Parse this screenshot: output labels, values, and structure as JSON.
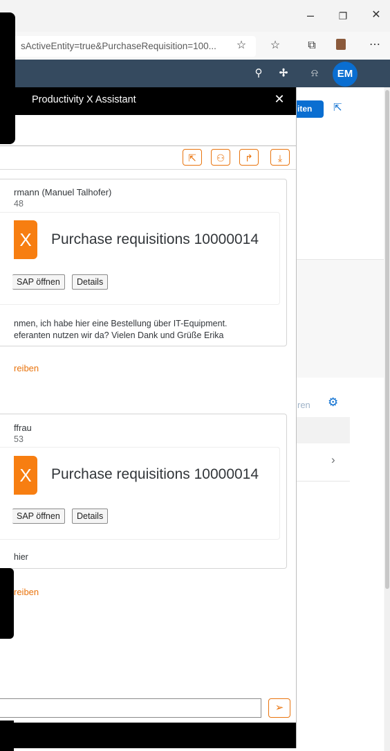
{
  "browser": {
    "url_fragment": "sActiveEntity=true&PurchaseRequisition=100...",
    "window_controls": [
      "–",
      "▢",
      "✕"
    ]
  },
  "shell": {
    "avatar_initials": "EM"
  },
  "background_page": {
    "edit_button_label": "iten",
    "muted_text": "ren"
  },
  "assistant": {
    "title": "Productivity X Assistant",
    "close_label": "✕",
    "cards": [
      {
        "sender": "rmann (Manuel Talhofer)",
        "sender_id": "48",
        "badge": "X",
        "object_title": "Purchase requisitions 10000014",
        "open_button": "SAP öffnen",
        "details_button": "Details",
        "message_lines": [
          "nmen, ich habe hier eine Bestellung über IT-Equipment.",
          "eferanten nutzen wir da? Vielen Dank und Grüße Erika"
        ],
        "reply_link": "reiben"
      },
      {
        "sender": "ffrau",
        "sender_id": "53",
        "badge": "X",
        "object_title": "Purchase requisitions 10000014",
        "open_button": "SAP öffnen",
        "details_button": "Details",
        "message_lines": [
          "hier"
        ],
        "reply_link": "reiben"
      }
    ],
    "input_value": ""
  },
  "colors": {
    "accent": "#e9730c",
    "badge": "#f77e11",
    "shell": "#354a5f",
    "primary": "#0a6ed1"
  }
}
